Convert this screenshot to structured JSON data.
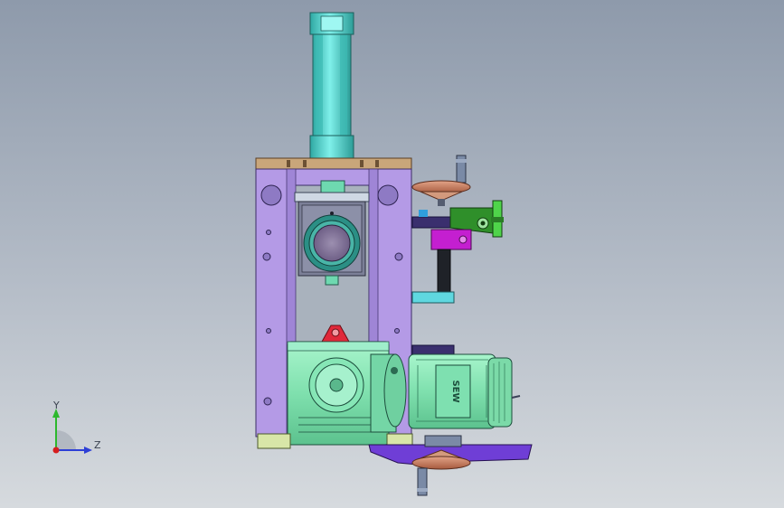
{
  "viewport": {
    "background_top": "#8e9aab",
    "background_bottom": "#d6dade"
  },
  "triad": {
    "y_label": "Y",
    "z_label": "Z",
    "y_color": "#2db82d",
    "z_color": "#2d3fd6",
    "x_color": "#d61e1e"
  },
  "motor": {
    "label": "SEW"
  },
  "colors": {
    "cylinder": "#4fd6cf",
    "frame": "#b49ae6",
    "top_plate": "#c9a67a",
    "gearbox": "#8ee8b8",
    "motor": "#8ee8b8",
    "bracket_green": "#2f8f2a",
    "bracket_magenta": "#c41fd0",
    "base_plate": "#6f3ed6",
    "handwheel": "#c8785a",
    "lifting_eye": "#e0283a"
  }
}
